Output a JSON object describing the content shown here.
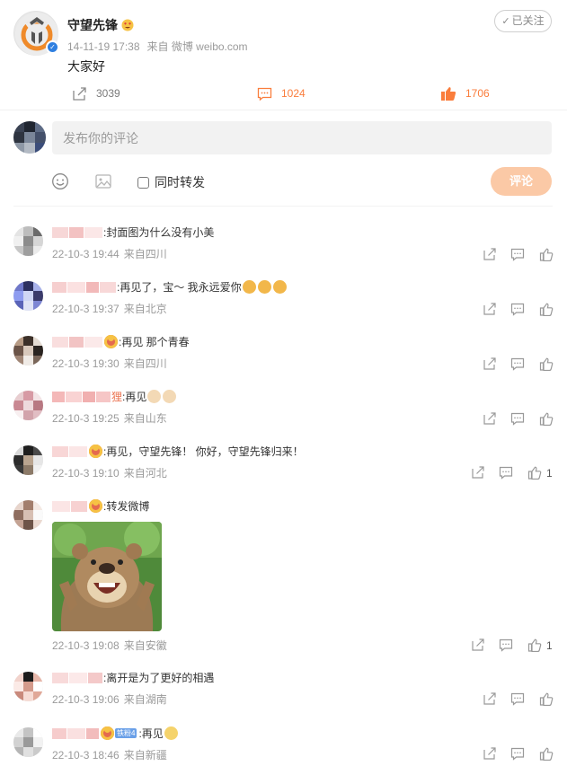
{
  "post": {
    "author": "守望先锋",
    "date": "14-11-19 17:38",
    "source": "来自 微博 weibo.com",
    "text": "大家好",
    "follow_label": "已关注",
    "follow_check": "✓",
    "reposts": "3039",
    "comments": "1024",
    "likes": "1706"
  },
  "composer": {
    "placeholder": "发布你的评论",
    "repost_label": "同时转发",
    "submit_label": "评论"
  },
  "comments": [
    {
      "prefix": "",
      "text": ":封面图为什么没有小美",
      "time": "22-10-3 19:44",
      "location": "来自四川",
      "likes": ""
    },
    {
      "prefix": "",
      "text": ":再见了，宝～ 我永远爱你",
      "time": "22-10-3 19:37",
      "location": "来自北京",
      "likes": ""
    },
    {
      "prefix": "",
      "text": ":再见 那个青春",
      "time": "22-10-3 19:30",
      "location": "来自四川",
      "likes": ""
    },
    {
      "prefix": "狸",
      "text": ":再见",
      "time": "22-10-3 19:25",
      "location": "来自山东",
      "likes": ""
    },
    {
      "prefix": "",
      "text": ":再见，守望先锋！ 你好，守望先锋归来！",
      "time": "22-10-3 19:10",
      "location": "来自河北",
      "likes": "1"
    },
    {
      "prefix": "",
      "text": ":转发微博",
      "time": "22-10-3 19:08",
      "location": "来自安徽",
      "likes": "1"
    },
    {
      "prefix": "",
      "text": ":离开是为了更好的相遇",
      "time": "22-10-3 19:06",
      "location": "来自湖南",
      "likes": ""
    },
    {
      "prefix": "",
      "badge": "铁粉4",
      "text": ":再见",
      "time": "22-10-3 18:46",
      "location": "来自新疆",
      "likes": ""
    }
  ],
  "colors": {
    "accent": "#fa7d3c",
    "submit_bg": "#fbc9a6",
    "verified": "#2f7fe0"
  }
}
